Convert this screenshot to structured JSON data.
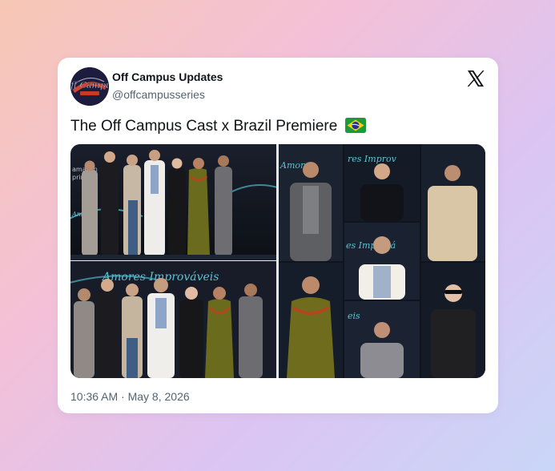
{
  "tweet": {
    "display_name": "Off Campus Updates",
    "handle": "@offcampusseries",
    "text": "The Off Campus Cast x Brazil Premiere",
    "emoji": "brazil-flag",
    "timestamp": "10:36 AM · May 8, 2026",
    "platform_icon": "x-logo-icon"
  },
  "avatar": {
    "icon": "off-campus-logo",
    "logo_text": "Off Campus"
  },
  "media": {
    "count": 3,
    "photos": [
      {
        "name": "cast-group-photo-top",
        "backdrop_text": "amazon prime  Amores Improváveis"
      },
      {
        "name": "cast-group-photo-bottom",
        "backdrop_text": "Amores Improváveis"
      },
      {
        "name": "cast-portrait-collage",
        "backdrop_text": "Amores Improváveis"
      }
    ]
  },
  "colors": {
    "card": "#ffffff",
    "text": "#0f1419",
    "secondary": "#536471",
    "backdrop": "#121722",
    "accent": "#4fb6c8"
  }
}
